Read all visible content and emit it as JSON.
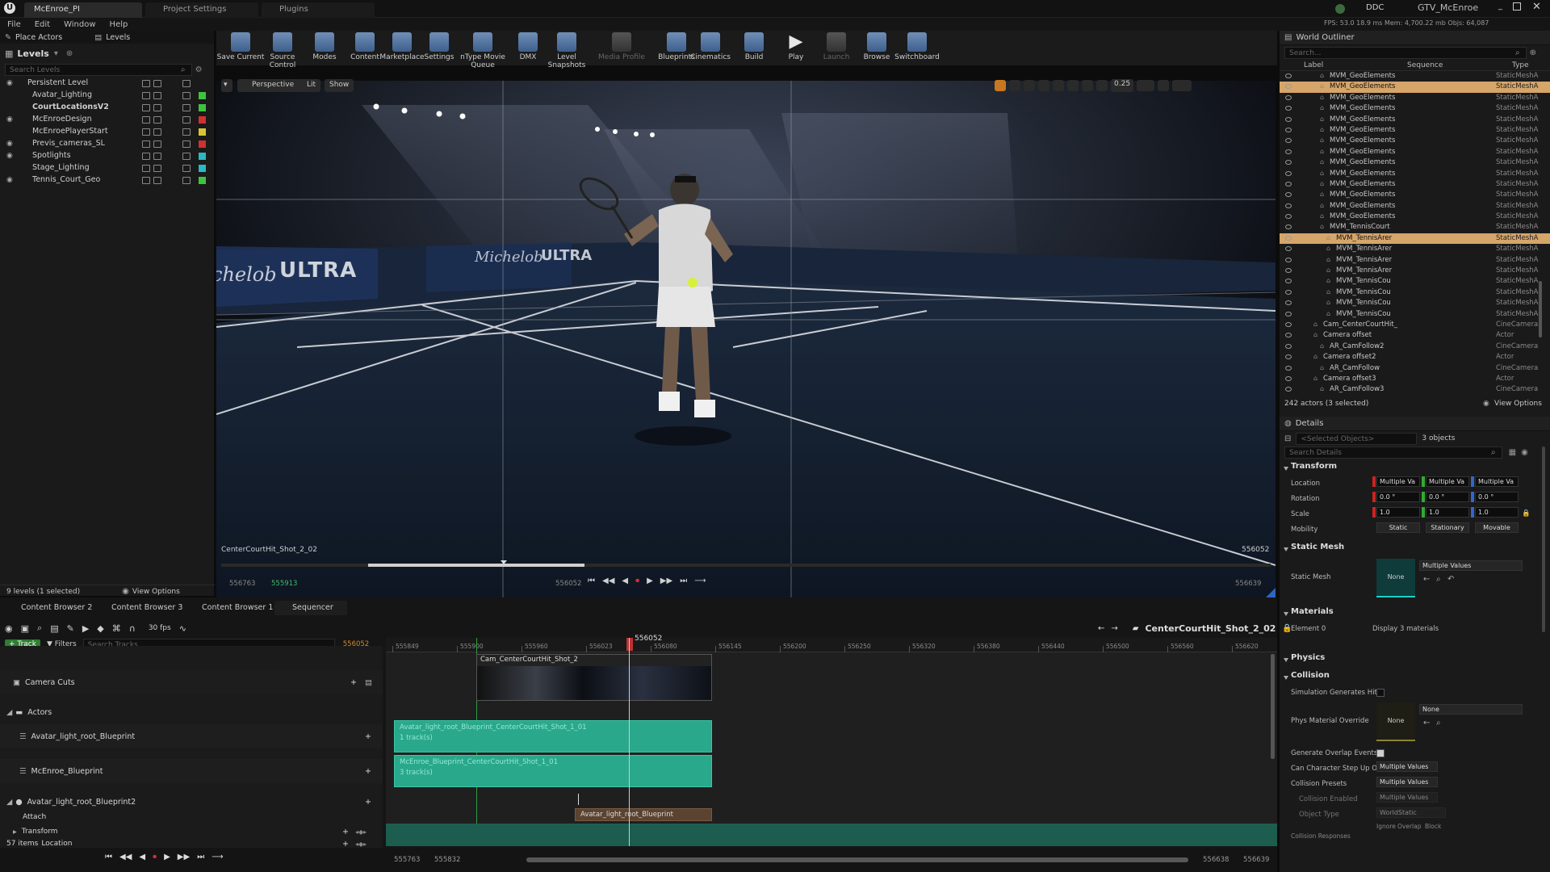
{
  "window": {
    "tabs": [
      "McEnroe_PI",
      "Project Settings",
      "Plugins"
    ],
    "right_title": "GTV_McEnroe",
    "badge": "DDC",
    "stats": "FPS: 53.0   18.9 ms   Mem: 4,700.22 mb   Objs: 64,087"
  },
  "menu": [
    "File",
    "Edit",
    "Window",
    "Help"
  ],
  "left_tabs": [
    "Place Actors",
    "Levels"
  ],
  "levels": {
    "title": "Levels",
    "search_placeholder": "Search Levels",
    "items": [
      {
        "name": "Persistent Level",
        "color": ""
      },
      {
        "name": "Avatar_Lighting",
        "color": "#3ec33e"
      },
      {
        "name": "CourtLocationsV2",
        "color": "#3ec33e"
      },
      {
        "name": "McEnroeDesign",
        "color": "#d23030"
      },
      {
        "name": "McEnroePlayerStart",
        "color": "#d8c430"
      },
      {
        "name": "Previs_cameras_SL",
        "color": "#d23030"
      },
      {
        "name": "Spotlights",
        "color": "#2ab8c4"
      },
      {
        "name": "Stage_Lighting",
        "color": "#2ab8c4"
      },
      {
        "name": "Tennis_Court_Geo",
        "color": "#3ec33e"
      }
    ],
    "footer": "9 levels (1 selected)",
    "view_options": "View Options"
  },
  "toolbar": [
    {
      "label": "Save Current",
      "enabled": true
    },
    {
      "label": "Source Control",
      "enabled": true
    },
    {
      "label": "Modes",
      "enabled": true
    },
    {
      "label": "Content",
      "enabled": true
    },
    {
      "label": "Marketplace",
      "enabled": true
    },
    {
      "label": "Settings",
      "enabled": true
    },
    {
      "label": "nType Movie Queue",
      "enabled": true
    },
    {
      "label": "DMX",
      "enabled": true
    },
    {
      "label": "Level Snapshots",
      "enabled": true
    },
    {
      "label": "Media Profile",
      "enabled": false
    },
    {
      "label": "Blueprints",
      "enabled": true
    },
    {
      "label": "Cinematics",
      "enabled": true
    },
    {
      "label": "Build",
      "enabled": true
    },
    {
      "label": "Play",
      "enabled": true
    },
    {
      "label": "Launch",
      "enabled": false
    },
    {
      "label": "Browse",
      "enabled": true
    },
    {
      "label": "Switchboard",
      "enabled": true
    }
  ],
  "viewport": {
    "mode": "Perspective",
    "lit": "Lit",
    "show": "Show",
    "shot_name": "CenterCourtHit_Shot_2_02",
    "frame_right": "556052",
    "snap_value": "0.25",
    "brand": "ULTRA",
    "brand_left": "chelob",
    "brand_script": "Michelob",
    "range_start": "556763",
    "range_mid": "555913",
    "playhead_frame": "556052",
    "range_end": "556639"
  },
  "outliner": {
    "title": "World Outliner",
    "search_placeholder": "Search...",
    "columns": [
      "Label",
      "Sequence",
      "Type"
    ],
    "rows": [
      {
        "label": "MVM_GeoElements",
        "type": "StaticMeshA",
        "indent": 1,
        "sel": false
      },
      {
        "label": "MVM_GeoElements",
        "type": "StaticMeshA",
        "indent": 1,
        "sel": true
      },
      {
        "label": "MVM_GeoElements",
        "type": "StaticMeshA",
        "indent": 1,
        "sel": false
      },
      {
        "label": "MVM_GeoElements",
        "type": "StaticMeshA",
        "indent": 1,
        "sel": false
      },
      {
        "label": "MVM_GeoElements",
        "type": "StaticMeshA",
        "indent": 1,
        "sel": false
      },
      {
        "label": "MVM_GeoElements",
        "type": "StaticMeshA",
        "indent": 1,
        "sel": false
      },
      {
        "label": "MVM_GeoElements",
        "type": "StaticMeshA",
        "indent": 1,
        "sel": false
      },
      {
        "label": "MVM_GeoElements",
        "type": "StaticMeshA",
        "indent": 1,
        "sel": false
      },
      {
        "label": "MVM_GeoElements",
        "type": "StaticMeshA",
        "indent": 1,
        "sel": false
      },
      {
        "label": "MVM_GeoElements",
        "type": "StaticMeshA",
        "indent": 1,
        "sel": false
      },
      {
        "label": "MVM_GeoElements",
        "type": "StaticMeshA",
        "indent": 1,
        "sel": false
      },
      {
        "label": "MVM_GeoElements",
        "type": "StaticMeshA",
        "indent": 1,
        "sel": false
      },
      {
        "label": "MVM_GeoElements",
        "type": "StaticMeshA",
        "indent": 1,
        "sel": false
      },
      {
        "label": "MVM_GeoElements",
        "type": "StaticMeshA",
        "indent": 1,
        "sel": false
      },
      {
        "label": "MVM_TennisCourt",
        "type": "StaticMeshA",
        "indent": 1,
        "sel": false
      },
      {
        "label": "MVM_TennisArer",
        "type": "StaticMeshA",
        "indent": 2,
        "sel": true
      },
      {
        "label": "MVM_TennisArer",
        "type": "StaticMeshA",
        "indent": 2,
        "sel": false
      },
      {
        "label": "MVM_TennisArer",
        "type": "StaticMeshA",
        "indent": 2,
        "sel": false
      },
      {
        "label": "MVM_TennisArer",
        "type": "StaticMeshA",
        "indent": 2,
        "sel": false
      },
      {
        "label": "MVM_TennisCou",
        "type": "StaticMeshA",
        "indent": 2,
        "sel": false
      },
      {
        "label": "MVM_TennisCou",
        "type": "StaticMeshA",
        "indent": 2,
        "sel": false
      },
      {
        "label": "MVM_TennisCou",
        "type": "StaticMeshA",
        "indent": 2,
        "sel": false
      },
      {
        "label": "MVM_TennisCou",
        "type": "StaticMeshA",
        "indent": 2,
        "sel": false
      },
      {
        "label": "Cam_CenterCourtHit_",
        "type": "CineCamera",
        "indent": 0,
        "sel": false
      },
      {
        "label": "Camera offset",
        "type": "Actor",
        "indent": 0,
        "sel": false
      },
      {
        "label": "AR_CamFollow2",
        "type": "CineCamera",
        "indent": 1,
        "sel": false
      },
      {
        "label": "Camera offset2",
        "type": "Actor",
        "indent": 0,
        "sel": false
      },
      {
        "label": "AR_CamFollow",
        "type": "CineCamera",
        "indent": 1,
        "sel": false
      },
      {
        "label": "Camera offset3",
        "type": "Actor",
        "indent": 0,
        "sel": false
      },
      {
        "label": "AR_CamFollow3",
        "type": "CineCamera",
        "indent": 1,
        "sel": false
      }
    ],
    "footer": "242 actors (3 selected)",
    "view_options": "View Options"
  },
  "details": {
    "title": "Details",
    "selected_placeholder": "<Selected Objects>",
    "count": "3 objects",
    "search_placeholder": "Search Details",
    "transform_header": "Transform",
    "location_label": "Location",
    "rotation_label": "Rotation",
    "scale_label": "Scale",
    "mobility_label": "Mobility",
    "location": [
      "Multiple Va",
      "Multiple Va",
      "Multiple Va"
    ],
    "rotation": [
      "0.0 °",
      "0.0 °",
      "0.0 °"
    ],
    "scale": [
      "1.0",
      "1.0",
      "1.0"
    ],
    "mobility": [
      "Static",
      "Stationary",
      "Movable"
    ],
    "static_mesh_header": "Static Mesh",
    "static_mesh_label": "Static Mesh",
    "static_mesh_thumb": "None",
    "static_mesh_value": "Multiple Values",
    "materials_header": "Materials",
    "element_label": "Element 0",
    "element_value": "Display 3 materials",
    "physics_header": "Physics",
    "collision_header": "Collision",
    "sim_hit": "Simulation Generates Hit",
    "phys_override": "Phys Material Override",
    "phys_thumb": "None",
    "phys_value": "None",
    "overlap": "Generate Overlap Events",
    "char_step": "Can Character Step Up On",
    "char_step_value": "Multiple Values",
    "presets": "Collision Presets",
    "presets_value": "Multiple Values",
    "coll_enabled": "Collision Enabled",
    "coll_enabled_value": "Multiple Values",
    "object_type": "Object Type",
    "object_type_value": "WorldStatic",
    "resp_cols": [
      "Ignore",
      "Overlap",
      "Block"
    ],
    "resp_label": "Collision Responses"
  },
  "bottom_tabs": [
    "Content Browser 2",
    "Content Browser 3",
    "Content Browser 1",
    "Sequencer"
  ],
  "sequencer": {
    "fps": "30 fps",
    "track_btn": "Track",
    "filters_btn": "Filters",
    "search_placeholder": "Search Tracks",
    "current_frame": "556052",
    "sequence_name": "CenterCourtHit_Shot_2_02",
    "ticks": [
      "555849",
      "555900",
      "555960",
      "556023",
      "556080",
      "556145",
      "556200",
      "556250",
      "556320",
      "556380",
      "556440",
      "556500",
      "556560",
      "556620"
    ],
    "tracks": {
      "camera_cuts": "Camera Cuts",
      "actors": "Actors",
      "avatar": "Avatar_light_root_Blueprint",
      "mcenroe": "McEnroe_Blueprint",
      "avatar2": "Avatar_light_root_Blueprint2",
      "attach": "Attach",
      "transform": "Transform",
      "location": "Location"
    },
    "cam_section": "Cam_CenterCourtHit_Shot_2",
    "sec1": "Avatar_light_root_Blueprint_CenterCourtHit_Shot_1_01",
    "sec1_sub": "1 track(s)",
    "sec2": "McEnroe_Blueprint_CenterCourtHit_Shot_1_01",
    "sec2_sub": "3 track(s)",
    "sec3": "Avatar_light_root_Blueprint",
    "count_label": "57 items",
    "bottom_start": "555763",
    "bottom_in": "555832",
    "bottom_out": "556638",
    "bottom_end": "556639"
  }
}
